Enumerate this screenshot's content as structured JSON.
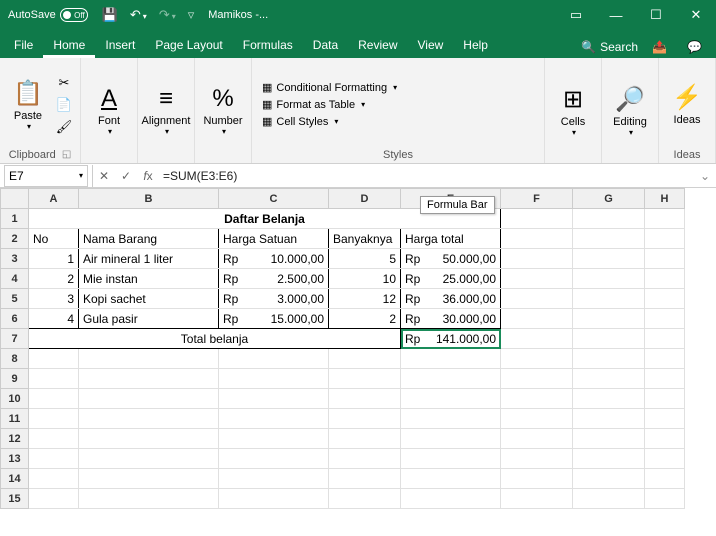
{
  "title_bar": {
    "autosave_label": "AutoSave",
    "autosave_state": "Off",
    "doc_name": "Mamikos -..."
  },
  "tabs": {
    "file": "File",
    "home": "Home",
    "insert": "Insert",
    "page_layout": "Page Layout",
    "formulas": "Formulas",
    "data": "Data",
    "review": "Review",
    "view": "View",
    "help": "Help",
    "search": "Search"
  },
  "ribbon": {
    "paste": "Paste",
    "clipboard": "Clipboard",
    "font": "Font",
    "alignment": "Alignment",
    "number": "Number",
    "cond_fmt": "Conditional Formatting",
    "fmt_table": "Format as Table",
    "cell_styles": "Cell Styles",
    "styles": "Styles",
    "cells": "Cells",
    "editing": "Editing",
    "ideas": "Ideas"
  },
  "name_box": "E7",
  "formula": "=SUM(E3:E6)",
  "tooltip": "Formula Bar",
  "columns": [
    "A",
    "B",
    "C",
    "D",
    "E",
    "F",
    "G",
    "H"
  ],
  "sheet": {
    "title": "Daftar Belanja",
    "headers": {
      "no": "No",
      "nama": "Nama Barang",
      "harga": "Harga Satuan",
      "banyak": "Banyaknya",
      "total": "Harga total"
    },
    "rows": [
      {
        "no": "1",
        "nama": "Air mineral 1 liter",
        "rp1": "Rp",
        "harga": "10.000,00",
        "banyak": "5",
        "rp2": "Rp",
        "total": "50.000,00"
      },
      {
        "no": "2",
        "nama": "Mie instan",
        "rp1": "Rp",
        "harga": "2.500,00",
        "banyak": "10",
        "rp2": "Rp",
        "total": "25.000,00"
      },
      {
        "no": "3",
        "nama": "Kopi sachet",
        "rp1": "Rp",
        "harga": "3.000,00",
        "banyak": "12",
        "rp2": "Rp",
        "total": "36.000,00"
      },
      {
        "no": "4",
        "nama": "Gula pasir",
        "rp1": "Rp",
        "harga": "15.000,00",
        "banyak": "2",
        "rp2": "Rp",
        "total": "30.000,00"
      }
    ],
    "total_label": "Total belanja",
    "total_rp": "Rp",
    "total_val": "141.000,00"
  }
}
